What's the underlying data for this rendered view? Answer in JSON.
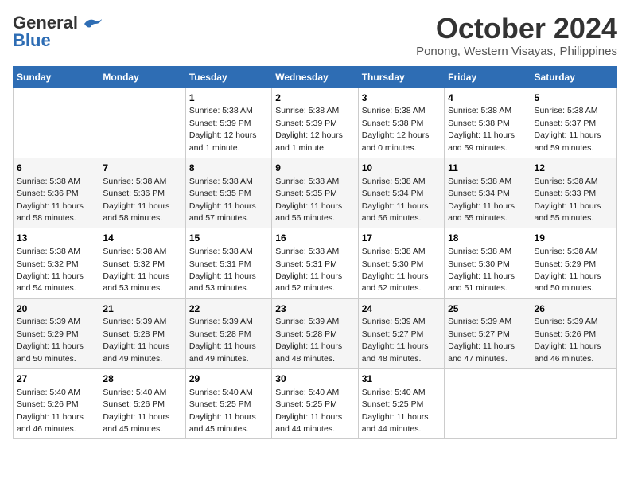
{
  "logo": {
    "general": "General",
    "blue": "Blue"
  },
  "title": "October 2024",
  "subtitle": "Ponong, Western Visayas, Philippines",
  "weekdays": [
    "Sunday",
    "Monday",
    "Tuesday",
    "Wednesday",
    "Thursday",
    "Friday",
    "Saturday"
  ],
  "weeks": [
    [
      null,
      null,
      {
        "day": 1,
        "sunrise": "5:38 AM",
        "sunset": "5:39 PM",
        "daylight": "12 hours and 1 minute."
      },
      {
        "day": 2,
        "sunrise": "5:38 AM",
        "sunset": "5:39 PM",
        "daylight": "12 hours and 1 minute."
      },
      {
        "day": 3,
        "sunrise": "5:38 AM",
        "sunset": "5:38 PM",
        "daylight": "12 hours and 0 minutes."
      },
      {
        "day": 4,
        "sunrise": "5:38 AM",
        "sunset": "5:38 PM",
        "daylight": "11 hours and 59 minutes."
      },
      {
        "day": 5,
        "sunrise": "5:38 AM",
        "sunset": "5:37 PM",
        "daylight": "11 hours and 59 minutes."
      }
    ],
    [
      {
        "day": 6,
        "sunrise": "5:38 AM",
        "sunset": "5:36 PM",
        "daylight": "11 hours and 58 minutes."
      },
      {
        "day": 7,
        "sunrise": "5:38 AM",
        "sunset": "5:36 PM",
        "daylight": "11 hours and 58 minutes."
      },
      {
        "day": 8,
        "sunrise": "5:38 AM",
        "sunset": "5:35 PM",
        "daylight": "11 hours and 57 minutes."
      },
      {
        "day": 9,
        "sunrise": "5:38 AM",
        "sunset": "5:35 PM",
        "daylight": "11 hours and 56 minutes."
      },
      {
        "day": 10,
        "sunrise": "5:38 AM",
        "sunset": "5:34 PM",
        "daylight": "11 hours and 56 minutes."
      },
      {
        "day": 11,
        "sunrise": "5:38 AM",
        "sunset": "5:34 PM",
        "daylight": "11 hours and 55 minutes."
      },
      {
        "day": 12,
        "sunrise": "5:38 AM",
        "sunset": "5:33 PM",
        "daylight": "11 hours and 55 minutes."
      }
    ],
    [
      {
        "day": 13,
        "sunrise": "5:38 AM",
        "sunset": "5:32 PM",
        "daylight": "11 hours and 54 minutes."
      },
      {
        "day": 14,
        "sunrise": "5:38 AM",
        "sunset": "5:32 PM",
        "daylight": "11 hours and 53 minutes."
      },
      {
        "day": 15,
        "sunrise": "5:38 AM",
        "sunset": "5:31 PM",
        "daylight": "11 hours and 53 minutes."
      },
      {
        "day": 16,
        "sunrise": "5:38 AM",
        "sunset": "5:31 PM",
        "daylight": "11 hours and 52 minutes."
      },
      {
        "day": 17,
        "sunrise": "5:38 AM",
        "sunset": "5:30 PM",
        "daylight": "11 hours and 52 minutes."
      },
      {
        "day": 18,
        "sunrise": "5:38 AM",
        "sunset": "5:30 PM",
        "daylight": "11 hours and 51 minutes."
      },
      {
        "day": 19,
        "sunrise": "5:38 AM",
        "sunset": "5:29 PM",
        "daylight": "11 hours and 50 minutes."
      }
    ],
    [
      {
        "day": 20,
        "sunrise": "5:39 AM",
        "sunset": "5:29 PM",
        "daylight": "11 hours and 50 minutes."
      },
      {
        "day": 21,
        "sunrise": "5:39 AM",
        "sunset": "5:28 PM",
        "daylight": "11 hours and 49 minutes."
      },
      {
        "day": 22,
        "sunrise": "5:39 AM",
        "sunset": "5:28 PM",
        "daylight": "11 hours and 49 minutes."
      },
      {
        "day": 23,
        "sunrise": "5:39 AM",
        "sunset": "5:28 PM",
        "daylight": "11 hours and 48 minutes."
      },
      {
        "day": 24,
        "sunrise": "5:39 AM",
        "sunset": "5:27 PM",
        "daylight": "11 hours and 48 minutes."
      },
      {
        "day": 25,
        "sunrise": "5:39 AM",
        "sunset": "5:27 PM",
        "daylight": "11 hours and 47 minutes."
      },
      {
        "day": 26,
        "sunrise": "5:39 AM",
        "sunset": "5:26 PM",
        "daylight": "11 hours and 46 minutes."
      }
    ],
    [
      {
        "day": 27,
        "sunrise": "5:40 AM",
        "sunset": "5:26 PM",
        "daylight": "11 hours and 46 minutes."
      },
      {
        "day": 28,
        "sunrise": "5:40 AM",
        "sunset": "5:26 PM",
        "daylight": "11 hours and 45 minutes."
      },
      {
        "day": 29,
        "sunrise": "5:40 AM",
        "sunset": "5:25 PM",
        "daylight": "11 hours and 45 minutes."
      },
      {
        "day": 30,
        "sunrise": "5:40 AM",
        "sunset": "5:25 PM",
        "daylight": "11 hours and 44 minutes."
      },
      {
        "day": 31,
        "sunrise": "5:40 AM",
        "sunset": "5:25 PM",
        "daylight": "11 hours and 44 minutes."
      },
      null,
      null
    ]
  ]
}
